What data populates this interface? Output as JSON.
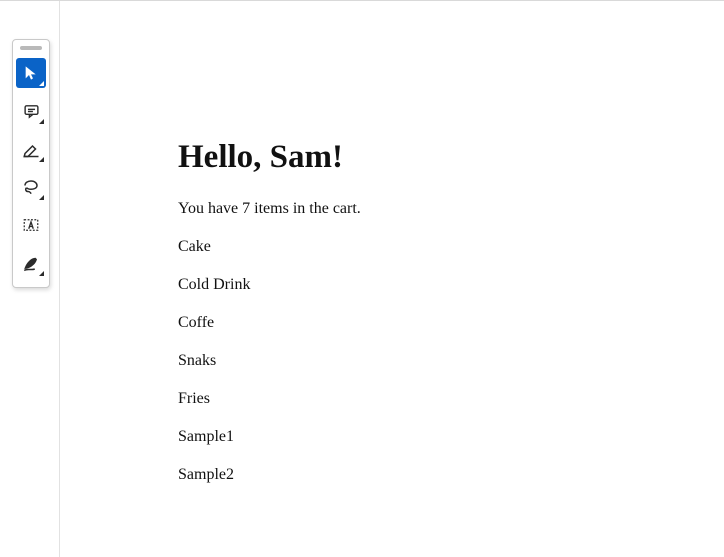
{
  "toolbox": {
    "tools": [
      {
        "name": "select-tool",
        "icon": "cursor",
        "active": true
      },
      {
        "name": "comment-tool",
        "icon": "comment",
        "active": false
      },
      {
        "name": "highlight-tool",
        "icon": "marker",
        "active": false
      },
      {
        "name": "freeform-tool",
        "icon": "lasso",
        "active": false
      },
      {
        "name": "text-box-tool",
        "icon": "textbox",
        "active": false
      },
      {
        "name": "signature-tool",
        "icon": "pen",
        "active": false
      }
    ]
  },
  "document": {
    "heading": "Hello, Sam!",
    "subline": "You have 7 items in the cart.",
    "items": [
      "Cake",
      "Cold Drink",
      "Coffe",
      "Snaks",
      "Fries",
      "Sample1",
      "Sample2"
    ]
  }
}
